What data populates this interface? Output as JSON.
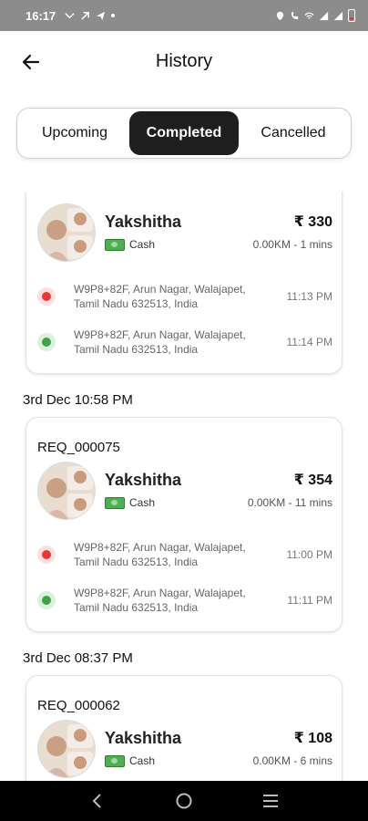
{
  "status_bar": {
    "time": "16:17",
    "left_icons": [
      "missed-call-icon",
      "link-icon",
      "telegram-icon",
      "dot-icon"
    ],
    "right_icons": [
      "location-icon",
      "vowifi-icon",
      "wifi-icon",
      "signal-icon",
      "signal-icon",
      "battery-low-icon"
    ]
  },
  "header": {
    "title": "History",
    "back_icon": "arrow-left-icon"
  },
  "tabs": [
    {
      "label": "Upcoming",
      "active": false
    },
    {
      "label": "Completed",
      "active": true
    },
    {
      "label": "Cancelled",
      "active": false
    }
  ],
  "rides": [
    {
      "date": "",
      "request_id": "",
      "rider_name": "Yakshitha",
      "payment_method": "Cash",
      "fare": "₹ 330",
      "distance_time": "0.00KM - 1 mins",
      "pickup": {
        "address": "W9P8+82F, Arun Nagar, Walajapet, Tamil Nadu 632513, India",
        "time": "11:13 PM"
      },
      "drop": {
        "address": "W9P8+82F, Arun Nagar, Walajapet, Tamil Nadu 632513, India",
        "time": "11:14 PM"
      }
    },
    {
      "date": "3rd Dec 10:58 PM",
      "request_id": "REQ_000075",
      "rider_name": "Yakshitha",
      "payment_method": "Cash",
      "fare": "₹ 354",
      "distance_time": "0.00KM - 11 mins",
      "pickup": {
        "address": "W9P8+82F, Arun Nagar, Walajapet, Tamil Nadu 632513, India",
        "time": "11:00 PM"
      },
      "drop": {
        "address": "W9P8+82F, Arun Nagar, Walajapet, Tamil Nadu 632513, India",
        "time": "11:11 PM"
      }
    },
    {
      "date": "3rd Dec 08:37 PM",
      "request_id": "REQ_000062",
      "rider_name": "Yakshitha",
      "payment_method": "Cash",
      "fare": "₹ 108",
      "distance_time": "0.00KM - 6 mins"
    }
  ],
  "colors": {
    "active_tab_bg": "#1e1e1e",
    "pickup_dot": "#e53935",
    "drop_dot": "#43a047",
    "status_bar_bg": "#8c8c8c",
    "nav_bar_bg": "#000000"
  },
  "nav_bar": {
    "icons": [
      "back-nav-icon",
      "home-nav-icon",
      "recents-nav-icon"
    ]
  }
}
